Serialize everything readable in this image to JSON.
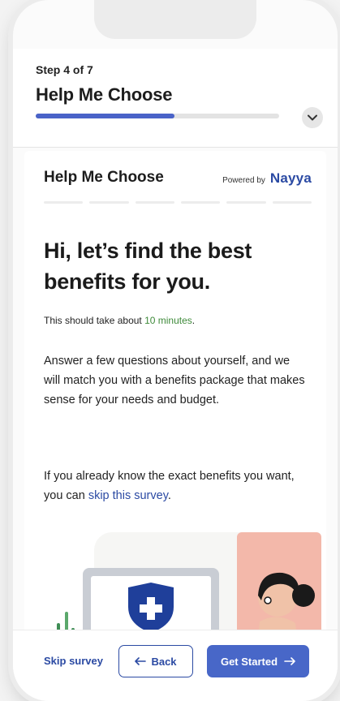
{
  "header": {
    "step_label": "Step 4 of 7",
    "title": "Help Me Choose",
    "progress": 0.57
  },
  "card": {
    "title": "Help Me Choose",
    "powered_by": "Powered by",
    "brand": "Nayya",
    "segments": 6,
    "headline": "Hi, let’s find the best benefits for you.",
    "duration_prefix": "This should take about ",
    "duration_value": "10 minutes",
    "duration_suffix": ".",
    "paragraph1": "Answer a few questions about yourself, and we will match you with a benefits package that makes sense for your needs and budget.",
    "paragraph2_prefix": "If you already know the exact benefits you want, you can ",
    "paragraph2_link": "skip this survey",
    "paragraph2_suffix": "."
  },
  "footer": {
    "skip_label": "Skip survey",
    "back_label": "Back",
    "start_label": "Get Started"
  },
  "colors": {
    "accent": "#4867c8",
    "brand": "#2b4aa3",
    "highlight": "#3e8a3a",
    "progress": "#4a63c8"
  },
  "icons": [
    "chevron-down-icon",
    "arrow-left-icon",
    "arrow-right-icon",
    "shield-cross-icon"
  ]
}
